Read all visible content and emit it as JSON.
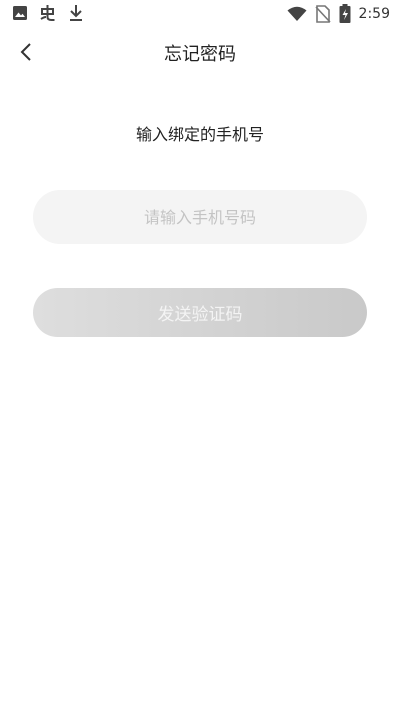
{
  "status_bar": {
    "time": "2:59",
    "left_icons": [
      "image-icon",
      "notification-app-icon",
      "download-icon"
    ],
    "right_icons": [
      "wifi-icon",
      "no-sim-icon",
      "battery-charging-icon"
    ]
  },
  "nav": {
    "title": "忘记密码",
    "back_icon": "chevron-left-icon"
  },
  "form": {
    "instruction": "输入绑定的手机号",
    "phone_placeholder": "请输入手机号码",
    "phone_value": "",
    "send_button_label": "发送验证码"
  },
  "colors": {
    "input_background": "#f4f4f4",
    "placeholder": "#c4c4c4",
    "button_gradient_start": "#dedede",
    "button_gradient_end": "#c9c9c9",
    "button_text": "#f4f4f4"
  }
}
